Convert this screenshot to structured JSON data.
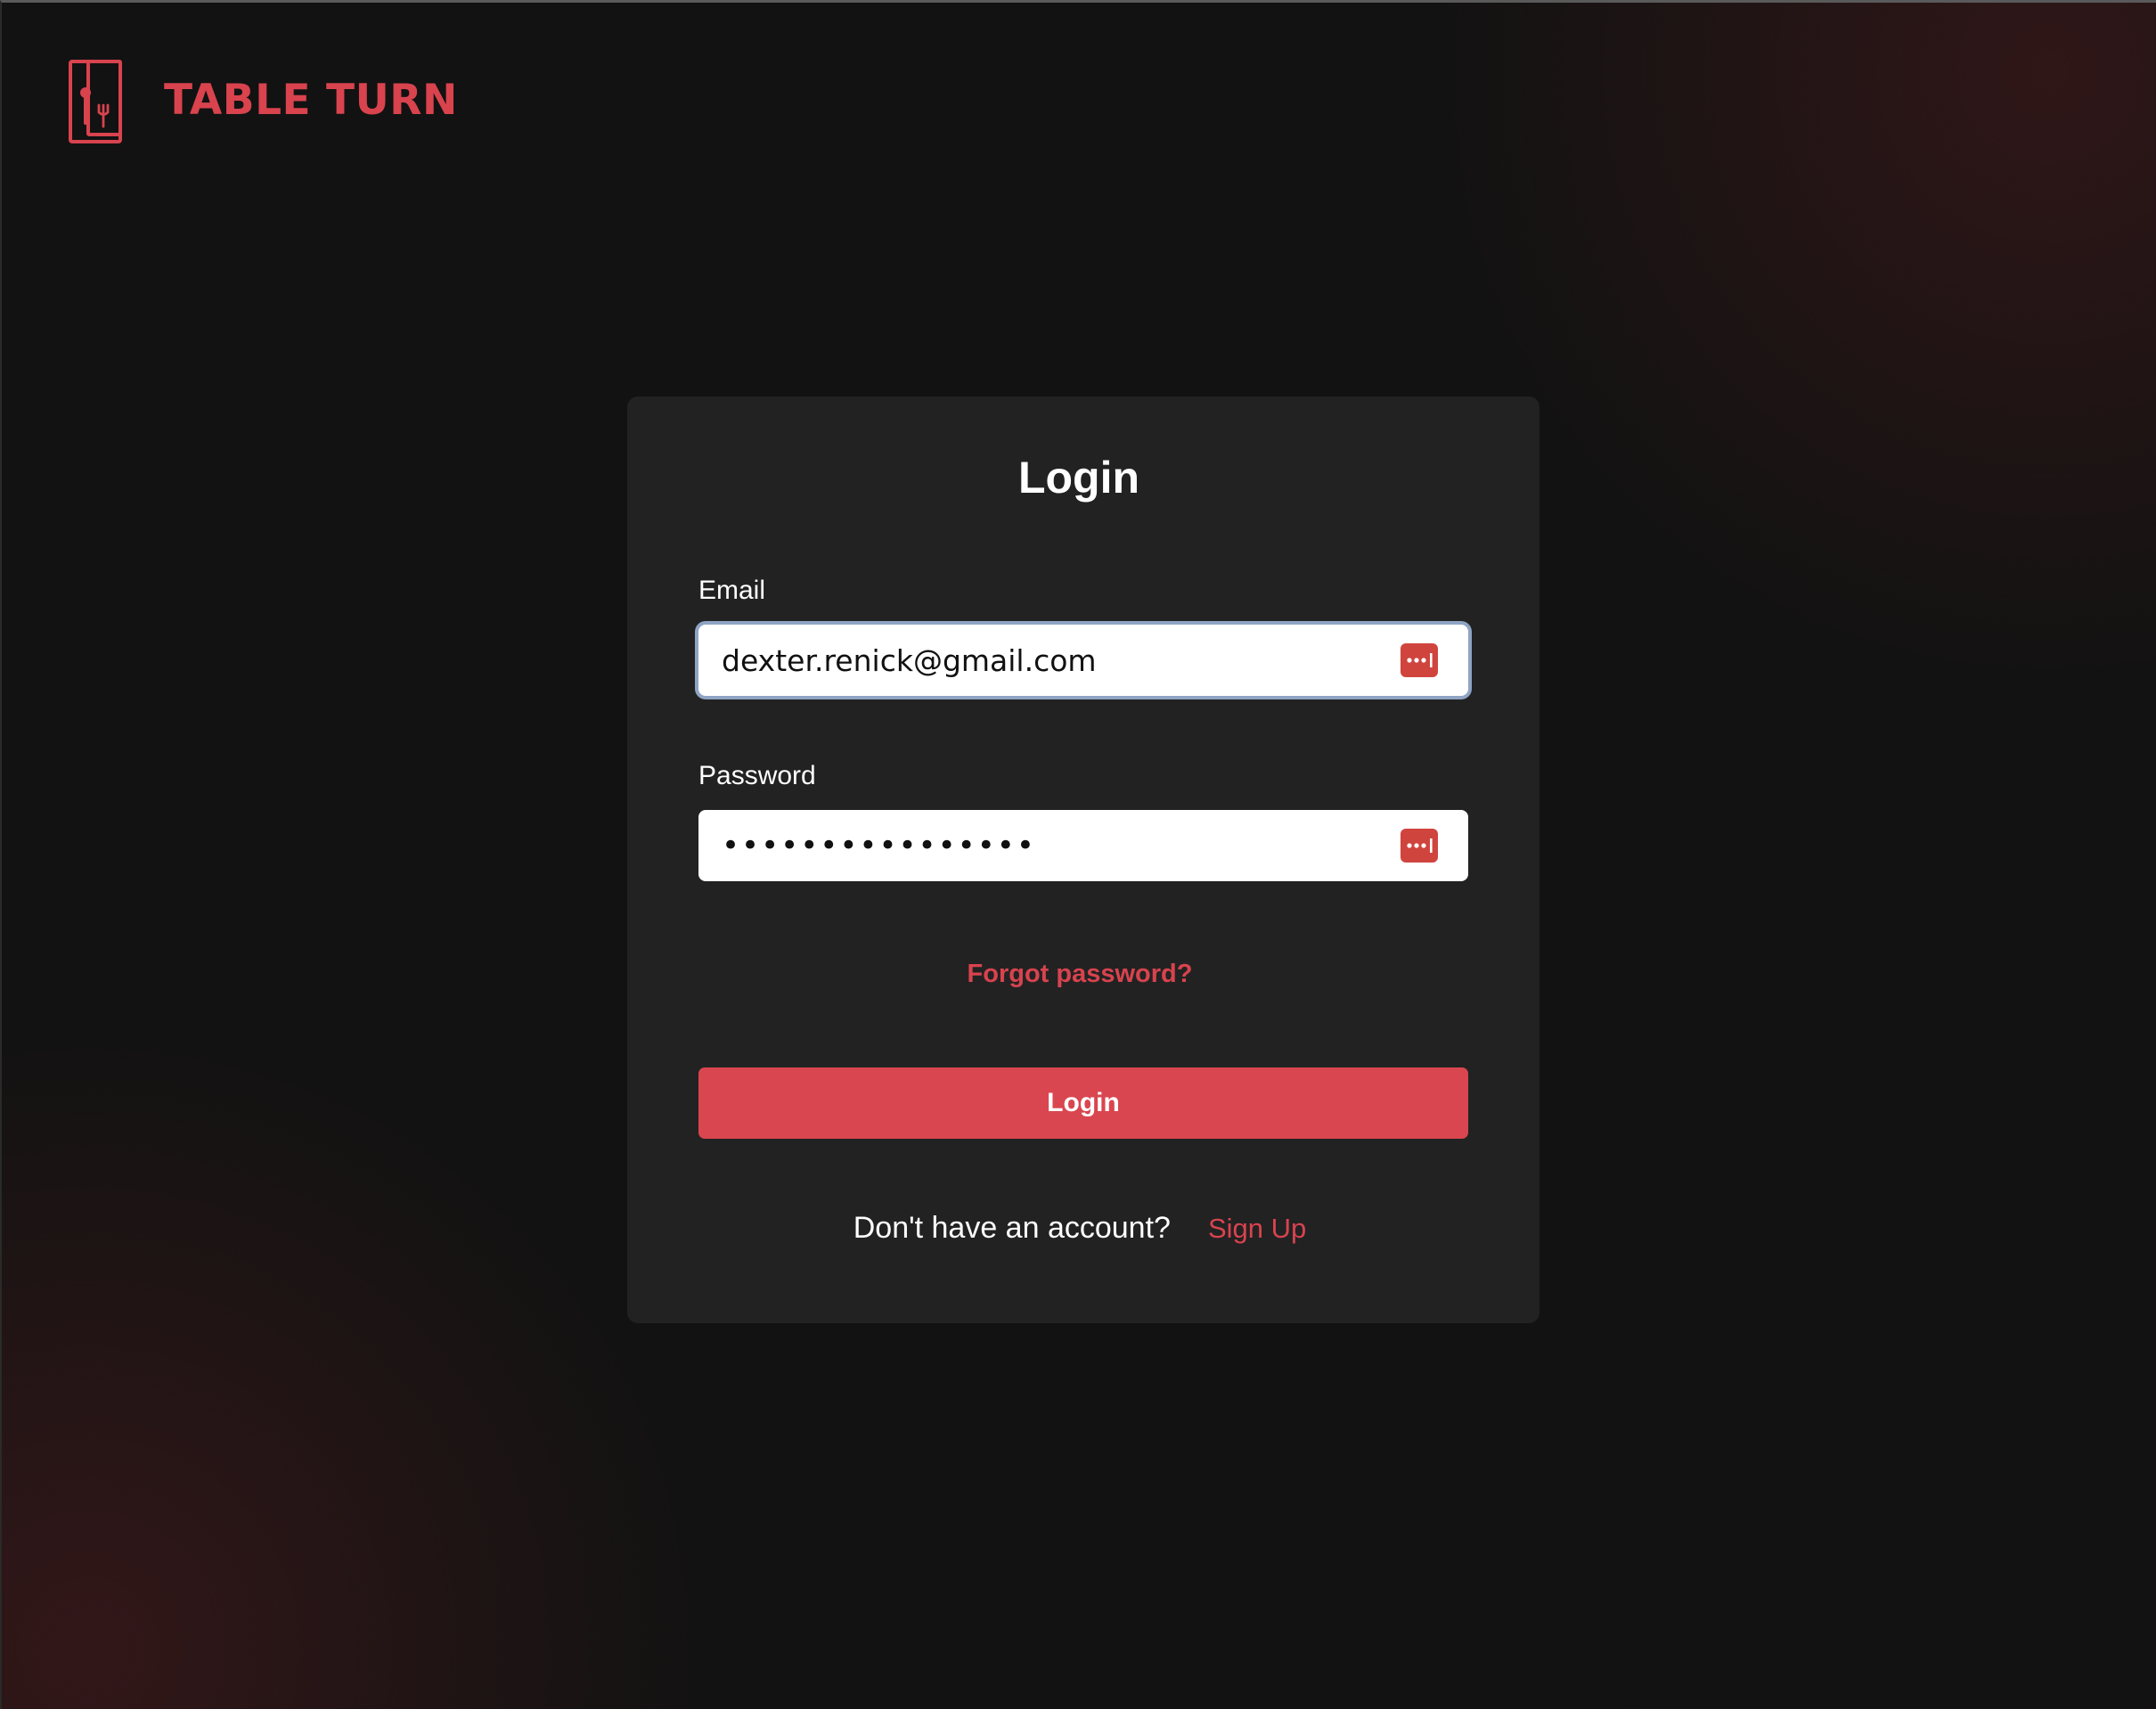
{
  "brand": {
    "name": "TABLE TURN",
    "logo_icon": "restaurant-menu-icon",
    "accent_color": "#d8434e"
  },
  "login_form": {
    "title": "Login",
    "email": {
      "label": "Email",
      "value": "dexter.renick@gmail.com",
      "autofill_icon": "password-manager-icon"
    },
    "password": {
      "label": "Password",
      "masked_value": "••••••••••••••••",
      "autofill_icon": "password-manager-icon"
    },
    "forgot_password_label": "Forgot password?",
    "submit_label": "Login",
    "signup_prompt": "Don't have an account?",
    "signup_link_label": "Sign Up"
  },
  "colors": {
    "background": "#121212",
    "card": "#222223",
    "button": "#d9464f",
    "focus_ring": "#8fa4c4"
  }
}
